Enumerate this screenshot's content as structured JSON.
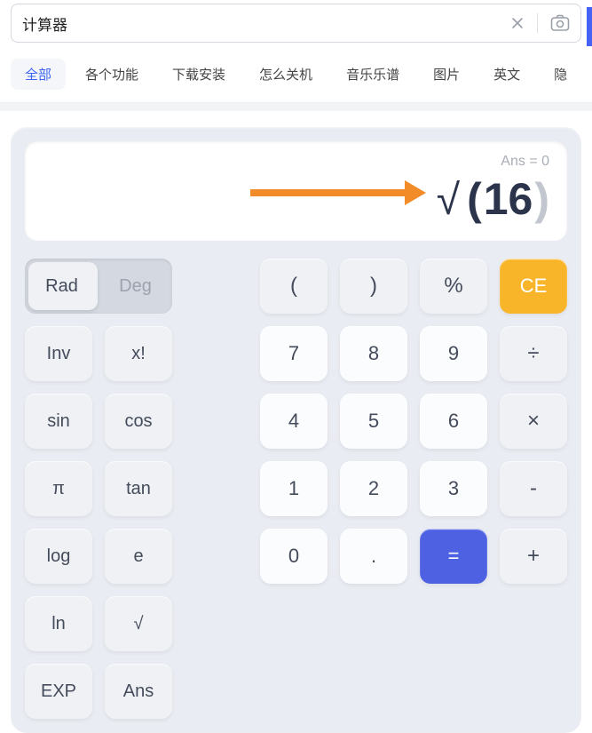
{
  "search": {
    "value": "计算器"
  },
  "tabs": {
    "items": [
      {
        "label": "全部",
        "active": true
      },
      {
        "label": "各个功能",
        "active": false
      },
      {
        "label": "下载安装",
        "active": false
      },
      {
        "label": "怎么关机",
        "active": false
      },
      {
        "label": "音乐乐谱",
        "active": false
      },
      {
        "label": "图片",
        "active": false
      },
      {
        "label": "英文",
        "active": false
      },
      {
        "label": "隐",
        "active": false
      }
    ]
  },
  "calculator": {
    "ans_label": "Ans = 0",
    "expr": {
      "op": "√",
      "lparen": "(",
      "value": "16",
      "rparen": ")"
    },
    "angle_mode": {
      "rad": "Rad",
      "deg": "Deg",
      "active": "rad"
    },
    "buttons": {
      "lparen": "(",
      "rparen": ")",
      "percent": "%",
      "ce": "CE",
      "inv": "Inv",
      "xfact": "x!",
      "n7": "7",
      "n8": "8",
      "n9": "9",
      "div": "÷",
      "sin": "sin",
      "cos": "cos",
      "n4": "4",
      "n5": "5",
      "n6": "6",
      "mul": "×",
      "pi": "π",
      "tan": "tan",
      "n1": "1",
      "n2": "2",
      "n3": "3",
      "sub": "-",
      "log": "log",
      "e": "e",
      "n0": "0",
      "dot": ".",
      "eq": "=",
      "add": "+",
      "ln": "ln",
      "sqrt": "√",
      "exp": "EXP",
      "ans": "Ans"
    }
  }
}
